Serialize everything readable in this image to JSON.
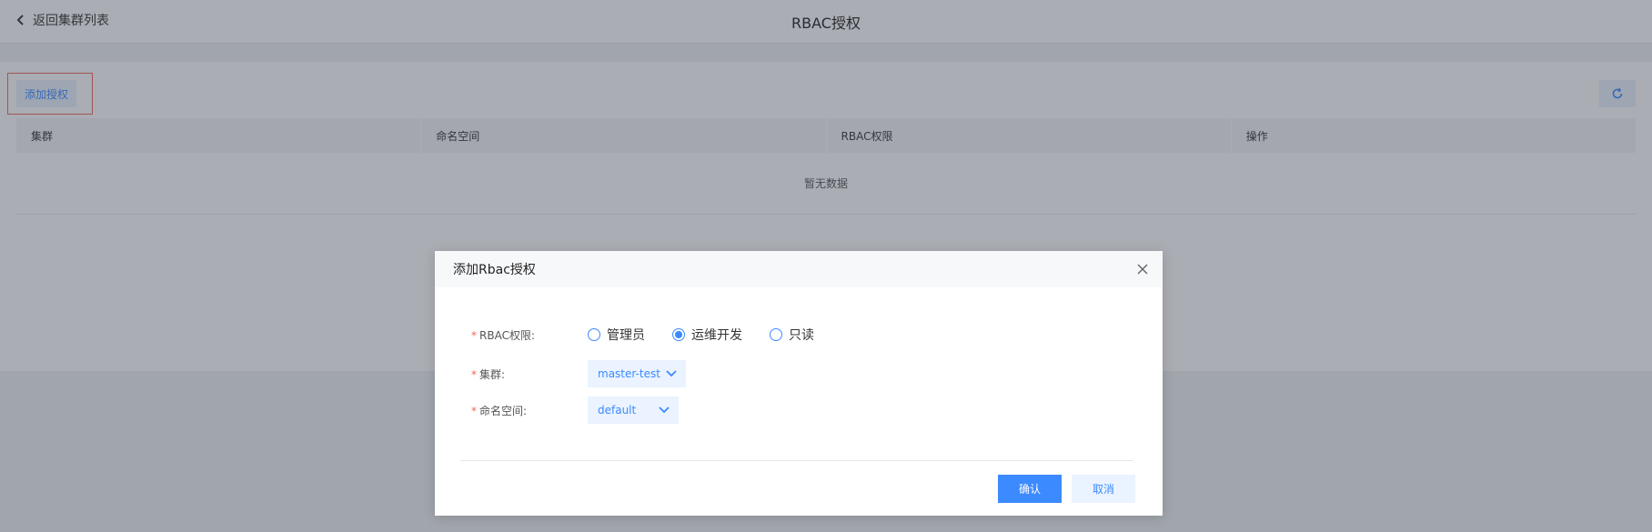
{
  "header": {
    "back_label": "返回集群列表",
    "title": "RBAC授权"
  },
  "toolbar": {
    "add_label": "添加授权"
  },
  "table": {
    "columns": [
      "集群",
      "命名空间",
      "RBAC权限",
      "操作"
    ],
    "empty_text": "暂无数据"
  },
  "dialog": {
    "title": "添加Rbac授权",
    "rbac_label": "RBAC权限:",
    "rbac_options": [
      {
        "label": "管理员",
        "selected": false
      },
      {
        "label": "运维开发",
        "selected": true
      },
      {
        "label": "只读",
        "selected": false
      }
    ],
    "cluster_label": "集群:",
    "cluster_value": "master-test",
    "namespace_label": "命名空间:",
    "namespace_value": "default",
    "confirm_label": "确认",
    "cancel_label": "取消"
  },
  "colors": {
    "accent": "#3c8aff",
    "accent_light": "#eaf3ff",
    "required": "#f0685a",
    "highlight_border": "#f0685a"
  },
  "icons": {
    "back": "chevron-left-icon",
    "refresh": "refresh-icon",
    "close": "close-icon",
    "dropdown": "chevron-down-icon"
  }
}
